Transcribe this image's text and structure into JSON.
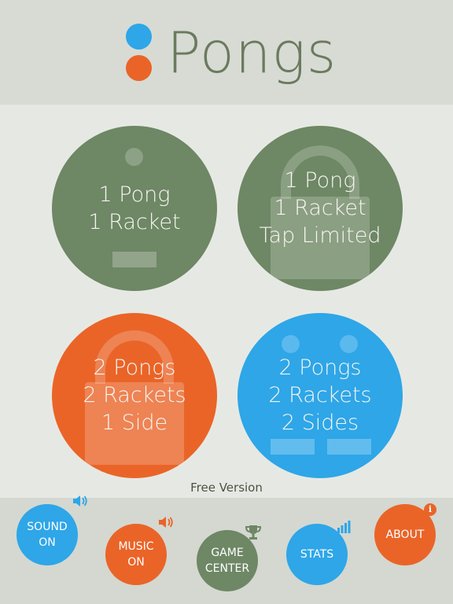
{
  "header": {
    "title": "Pongs"
  },
  "modes": [
    {
      "lines": [
        "1 Pong",
        "1 Racket"
      ],
      "color": "#6e8765",
      "locked": false
    },
    {
      "lines": [
        "1 Pong",
        "1 Racket",
        "Tap Limited"
      ],
      "color": "#6e8765",
      "locked": true
    },
    {
      "lines": [
        "2 Pongs",
        "2 Rackets",
        "1 Side"
      ],
      "color": "#ea6428",
      "locked": true
    },
    {
      "lines": [
        "2 Pongs",
        "2 Rackets",
        "2 Sides"
      ],
      "color": "#2ea6e8",
      "locked": false
    }
  ],
  "version_label": "Free Version",
  "footer": {
    "sound": {
      "line1": "SOUND",
      "line2": "ON",
      "icon": "speaker-icon"
    },
    "music": {
      "line1": "MUSIC",
      "line2": "ON",
      "icon": "speaker-icon"
    },
    "game_center": {
      "line1": "GAME",
      "line2": "CENTER",
      "icon": "trophy-icon"
    },
    "stats": {
      "label": "STATS",
      "icon": "bar-chart-icon"
    },
    "about": {
      "label": "ABOUT",
      "icon": "info-icon",
      "badge": "i"
    }
  },
  "colors": {
    "green": "#6e8765",
    "orange": "#ea6428",
    "blue": "#2ea6e8"
  }
}
